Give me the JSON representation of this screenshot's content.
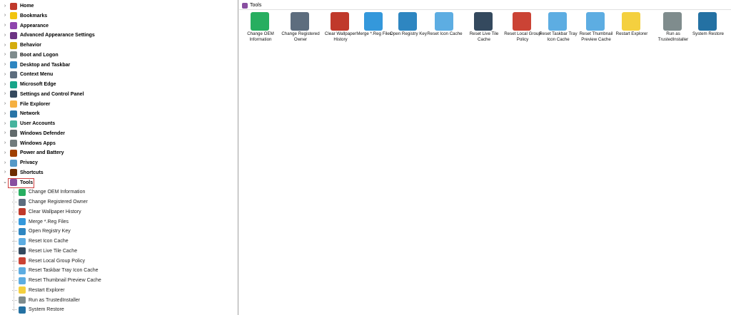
{
  "tree": {
    "categories": [
      {
        "label": "Home",
        "color": "#c0392b"
      },
      {
        "label": "Bookmarks",
        "color": "#f1c40f"
      },
      {
        "label": "Appearance",
        "color": "#8e44ad"
      },
      {
        "label": "Advanced Appearance Settings",
        "color": "#6c3483"
      },
      {
        "label": "Behavior",
        "color": "#d4ac0d"
      },
      {
        "label": "Boot and Logon",
        "color": "#7f8c8d"
      },
      {
        "label": "Desktop and Taskbar",
        "color": "#2e86c1"
      },
      {
        "label": "Context Menu",
        "color": "#5d6d7e"
      },
      {
        "label": "Microsoft Edge",
        "color": "#17a589"
      },
      {
        "label": "Settings and Control Panel",
        "color": "#34495e"
      },
      {
        "label": "File Explorer",
        "color": "#f5b041"
      },
      {
        "label": "Network",
        "color": "#2874a6"
      },
      {
        "label": "User Accounts",
        "color": "#45b39d"
      },
      {
        "label": "Windows Defender",
        "color": "#616a6b"
      },
      {
        "label": "Windows Apps",
        "color": "#707b7c"
      },
      {
        "label": "Power and Battery",
        "color": "#a04000"
      },
      {
        "label": "Privacy",
        "color": "#5499c7"
      },
      {
        "label": "Shortcuts",
        "color": "#6e2c00"
      },
      {
        "label": "Tools",
        "color": "#884ea0"
      }
    ],
    "tools_children": [
      {
        "label": "Change OEM Information",
        "color": "#27ae60"
      },
      {
        "label": "Change Registered Owner",
        "color": "#5d6d7e"
      },
      {
        "label": "Clear Wallpaper History",
        "color": "#c0392b"
      },
      {
        "label": "Merge *.Reg Files",
        "color": "#3498db"
      },
      {
        "label": "Open Registry Key",
        "color": "#2e86c1"
      },
      {
        "label": "Reset Icon Cache",
        "color": "#5dade2"
      },
      {
        "label": "Reset Live Tile Cache",
        "color": "#34495e"
      },
      {
        "label": "Reset Local Group Policy",
        "color": "#cb4335"
      },
      {
        "label": "Reset Taskbar Tray Icon Cache",
        "color": "#5dade2"
      },
      {
        "label": "Reset Thumbnail Preview Cache",
        "color": "#5dade2"
      },
      {
        "label": "Restart Explorer",
        "color": "#f4d03f"
      },
      {
        "label": "Run as TrustedInstaller",
        "color": "#7f8c8d"
      },
      {
        "label": "System Restore",
        "color": "#2471a3"
      }
    ]
  },
  "breadcrumb": {
    "label": "Tools"
  },
  "tiles": [
    {
      "label": "Change OEM Information",
      "color": "#27ae60"
    },
    {
      "label": "Change Registered Owner",
      "color": "#5d6d7e"
    },
    {
      "label": "Clear Wallpaper History",
      "color": "#c0392b"
    },
    {
      "label": "Merge *.Reg Files",
      "color": "#3498db"
    },
    {
      "label": "Open Registry Key",
      "color": "#2e86c1"
    },
    {
      "label": "Reset Icon Cache",
      "color": "#5dade2"
    },
    {
      "label": "Reset Live Tile Cache",
      "color": "#34495e"
    },
    {
      "label": "Reset Local Group Policy",
      "color": "#cb4335"
    },
    {
      "label": "Reset Taskbar Tray Icon Cache",
      "color": "#5dade2"
    },
    {
      "label": "Reset Thumbnail Preview Cache",
      "color": "#5dade2"
    },
    {
      "label": "Restart Explorer",
      "color": "#f4d03f"
    },
    {
      "label": "Run as TrustedInstaller",
      "color": "#7f8c8d"
    },
    {
      "label": "System Restore",
      "color": "#2471a3"
    }
  ],
  "icons": {
    "expander_collapsed": "›",
    "expander_expanded": "⌄"
  }
}
